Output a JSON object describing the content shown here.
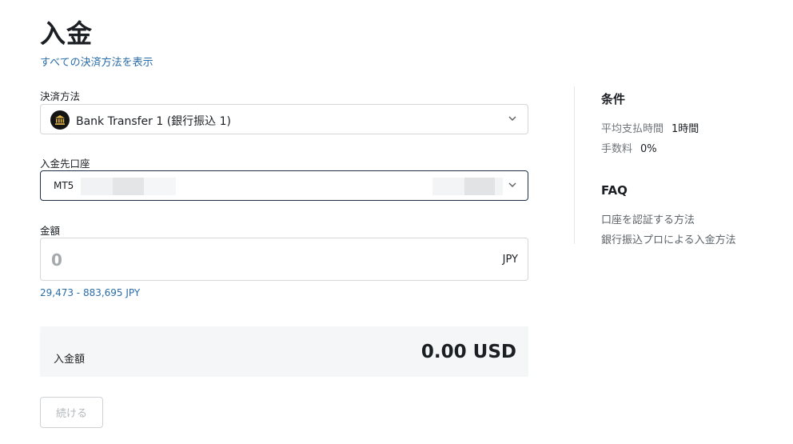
{
  "page": {
    "title": "入金",
    "show_all_link": "すべての決済方法を表示"
  },
  "payment_method": {
    "label": "決済方法",
    "selected": "Bank Transfer 1 (銀行振込 1)",
    "icon": "bank-icon"
  },
  "account": {
    "label": "入金先口座",
    "type": "MT5"
  },
  "amount": {
    "label": "金額",
    "placeholder": "0",
    "currency": "JPY",
    "range": "29,473 - 883,695 JPY"
  },
  "summary": {
    "label": "入金額",
    "value": "0.00 USD"
  },
  "continue_button": "続ける",
  "conditions": {
    "heading": "条件",
    "rows": [
      {
        "key": "平均支払時間",
        "value": "1時間"
      },
      {
        "key": "手数料",
        "value": "0%"
      }
    ]
  },
  "faq": {
    "heading": "FAQ",
    "links": [
      "口座を認証する方法",
      "銀行振込プロによる入金方法"
    ]
  },
  "colors": {
    "link": "#2a6ca8",
    "focus_border": "#1e2f48",
    "summary_bg": "#f4f6f7"
  }
}
